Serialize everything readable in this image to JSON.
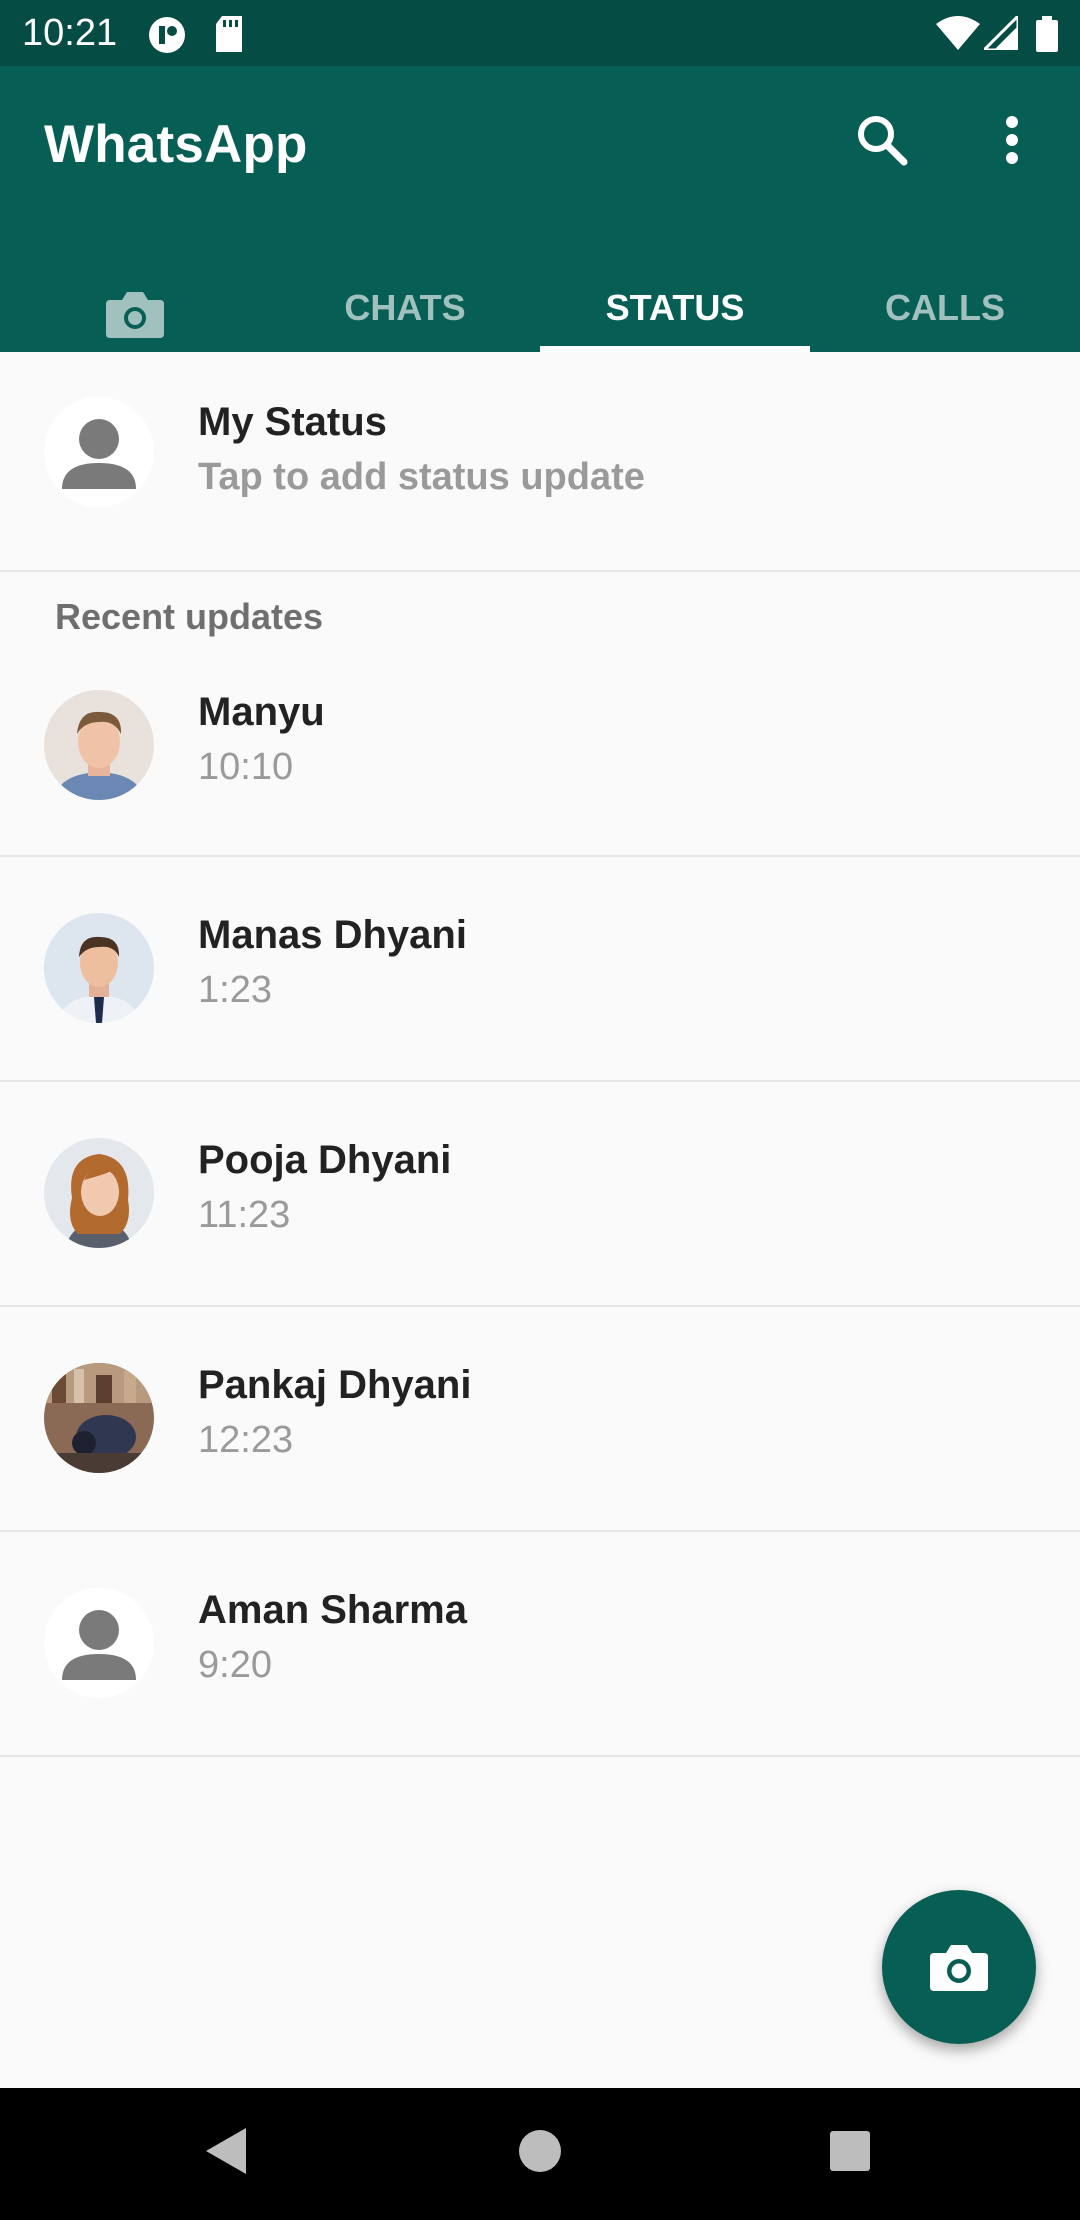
{
  "status_bar": {
    "time": "10:21"
  },
  "app": {
    "title": "WhatsApp",
    "tabs": [
      {
        "label": "",
        "icon": "camera-icon"
      },
      {
        "label": "CHATS"
      },
      {
        "label": "STATUS",
        "active": true
      },
      {
        "label": "CALLS"
      }
    ]
  },
  "my_status": {
    "name": "My Status",
    "subtitle": "Tap to add status update"
  },
  "recent_header": "Recent updates",
  "updates": [
    {
      "name": "Manyu",
      "time": "10:10"
    },
    {
      "name": "Manas Dhyani",
      "time": "1:23"
    },
    {
      "name": "Pooja Dhyani",
      "time": "11:23"
    },
    {
      "name": "Pankaj Dhyani",
      "time": "12:23"
    },
    {
      "name": "Aman Sharma",
      "time": "9:20"
    }
  ],
  "colors": {
    "primary": "#075e54",
    "statusbar": "#054c44",
    "background": "#fafafa"
  }
}
